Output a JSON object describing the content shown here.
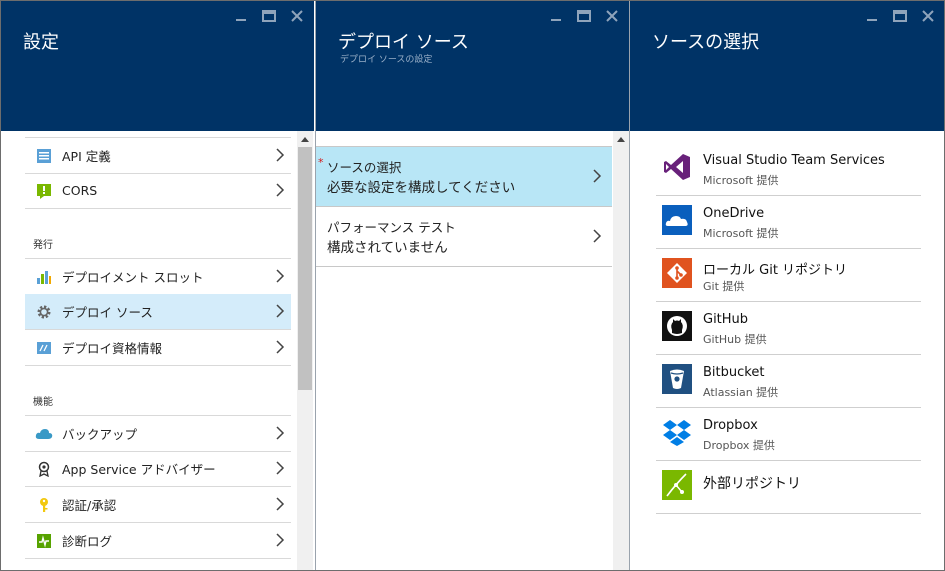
{
  "blade1": {
    "title": "設定",
    "items_top": [
      {
        "label": "API 定義",
        "icon": "api-definition-icon"
      },
      {
        "label": "CORS",
        "icon": "cors-icon"
      }
    ],
    "section_publish": "発行",
    "items_publish": [
      {
        "label": "デプロイメント スロット",
        "icon": "deployment-slots-icon"
      },
      {
        "label": "デプロイ ソース",
        "icon": "gear-icon",
        "selected": true
      },
      {
        "label": "デプロイ資格情報",
        "icon": "deployment-credentials-icon"
      }
    ],
    "section_features": "機能",
    "items_features": [
      {
        "label": "バックアップ",
        "icon": "backup-cloud-icon"
      },
      {
        "label": "App Service アドバイザー",
        "icon": "advisor-icon"
      },
      {
        "label": "認証/承認",
        "icon": "key-icon"
      },
      {
        "label": "診断ログ",
        "icon": "diagnostic-logs-icon"
      }
    ]
  },
  "blade2": {
    "title": "デプロイ ソース",
    "subtitle": "デプロイ ソースの設定",
    "items": [
      {
        "label": "ソースの選択",
        "value": "必要な設定を構成してください",
        "required": "*",
        "selected": true
      },
      {
        "label": "パフォーマンス テスト",
        "value": "構成されていません"
      }
    ]
  },
  "blade3": {
    "title": "ソースの選択",
    "sources": [
      {
        "name": "Visual Studio Team Services",
        "provider": "Microsoft 提供",
        "icon": "visual-studio-icon",
        "color": "#68217a"
      },
      {
        "name": "OneDrive",
        "provider": "Microsoft 提供",
        "icon": "onedrive-icon",
        "color": "#0a5fbd"
      },
      {
        "name": "ローカル Git リポジトリ",
        "provider": "Git 提供",
        "icon": "git-icon",
        "color": "#e0531f"
      },
      {
        "name": "GitHub",
        "provider": "GitHub 提供",
        "icon": "github-icon",
        "color": "#111111"
      },
      {
        "name": "Bitbucket",
        "provider": "Atlassian 提供",
        "icon": "bitbucket-icon",
        "color": "#205081"
      },
      {
        "name": "Dropbox",
        "provider": "Dropbox 提供",
        "icon": "dropbox-icon",
        "color": "#007ee5"
      },
      {
        "name": "外部リポジトリ",
        "provider": "",
        "icon": "external-repository-icon",
        "color": "#7ab800"
      }
    ]
  },
  "colors": {
    "header": "#003366",
    "selected_row": "#d4ecfa",
    "selected_row_blade2": "#b8e6f6",
    "required": "#d41818"
  }
}
